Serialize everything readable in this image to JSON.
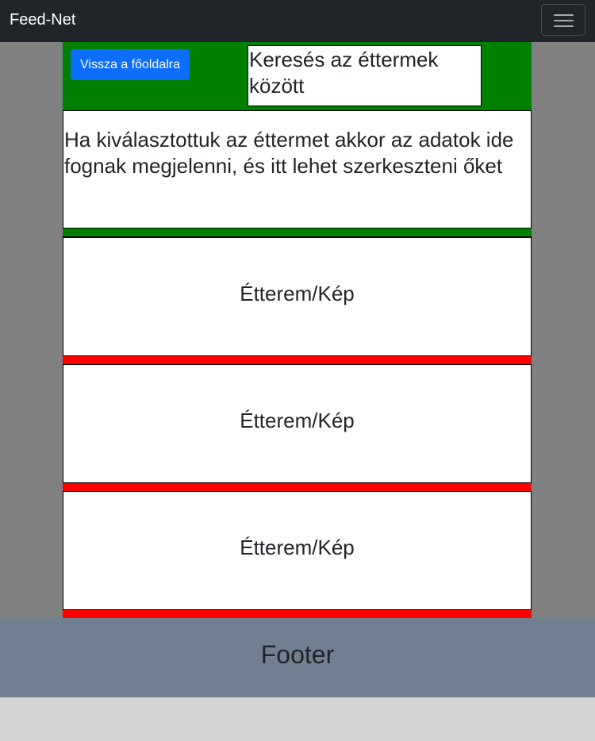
{
  "navbar": {
    "brand": "Feed-Net",
    "toggle_icon": "hamburger-menu-icon"
  },
  "toolbar": {
    "back_label": "Vissza a főoldalra",
    "search_text": "Keresés az éttermek között"
  },
  "info_panel": {
    "text": "Ha kiválasztottuk az éttermet akkor az adatok ide fognak megjelenni, és itt lehet szerkeszteni őket"
  },
  "cards": [
    {
      "label": "Étterem/Kép"
    },
    {
      "label": "Étterem/Kép"
    },
    {
      "label": "Étterem/Kép"
    }
  ],
  "footer": {
    "label": "Footer"
  },
  "colors": {
    "navbar": "#212529",
    "header_bar": "#008000",
    "card_separator": "#ff0000",
    "primary_button": "#0d6efd",
    "footer": "#708090",
    "page_background": "#808080"
  }
}
